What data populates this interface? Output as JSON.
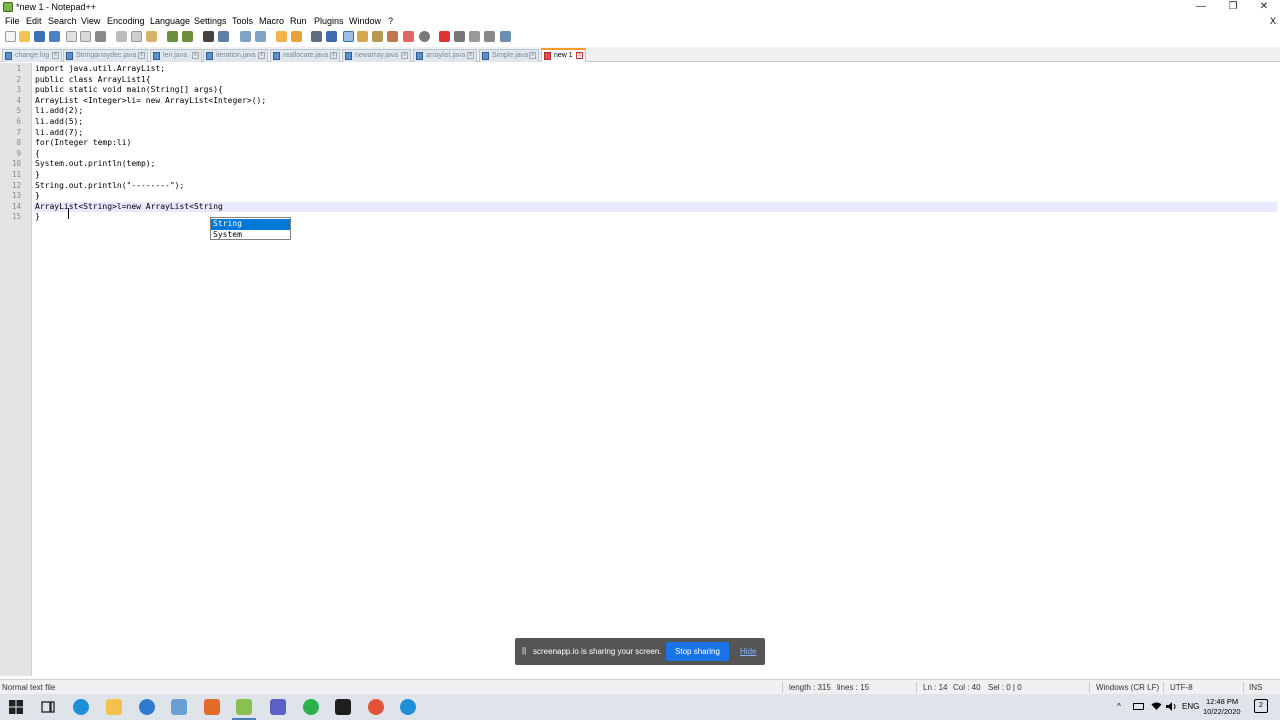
{
  "window": {
    "title": "*new 1 - Notepad++",
    "minimize_glyph": "—",
    "restore_glyph": "❐",
    "close_glyph": "✕"
  },
  "menu": {
    "items": [
      "File",
      "Edit",
      "Search",
      "View",
      "Encoding",
      "Language",
      "Settings",
      "Tools",
      "Macro",
      "Run",
      "Plugins",
      "Window",
      "?"
    ],
    "close_glyph": "X"
  },
  "tabs": [
    {
      "label": "change.log",
      "active": false
    },
    {
      "label": "Stringarraydec.java",
      "active": false
    },
    {
      "label": "len.java",
      "active": false
    },
    {
      "label": "iteration.java",
      "active": false
    },
    {
      "label": "reallocate.java",
      "active": false
    },
    {
      "label": "newarray.java",
      "active": false
    },
    {
      "label": "arraylist.java",
      "active": false
    },
    {
      "label": "Simple.java",
      "active": false
    },
    {
      "label": "new 1",
      "active": true
    }
  ],
  "editor": {
    "lines": [
      "import java.util.ArrayList;",
      "public class ArrayList1{",
      "public static void main(String[] args){",
      "ArrayList <Integer>li= new ArrayList<Integer>();",
      "li.add(2);",
      "li.add(5);",
      "li.add(7);",
      "for(Integer temp:li)",
      "{",
      "System.out.println(temp);",
      "}",
      "String.out.println(\"--------\");",
      "}",
      "ArrayList<String>l=new ArrayList<String",
      "}"
    ],
    "current_line": 14
  },
  "autocomplete": {
    "items": [
      "String",
      "System"
    ],
    "selected": 0
  },
  "share_banner": {
    "pause_glyph": "||",
    "message": "screenapp.io is sharing your screen.",
    "stop_label": "Stop sharing",
    "hide_label": "Hide"
  },
  "status": {
    "file_type": "Normal text file",
    "length": "length : 315",
    "lines": "lines : 15",
    "ln": "Ln : 14",
    "col": "Col : 40",
    "sel": "Sel : 0 | 0",
    "eol": "Windows (CR LF)",
    "encoding": "UTF-8",
    "mode": "INS"
  },
  "taskbar": {
    "tray_arrow": "^",
    "language": "ENG",
    "time": "12:48 PM",
    "date": "10/22/2020",
    "notification_count": "2"
  }
}
